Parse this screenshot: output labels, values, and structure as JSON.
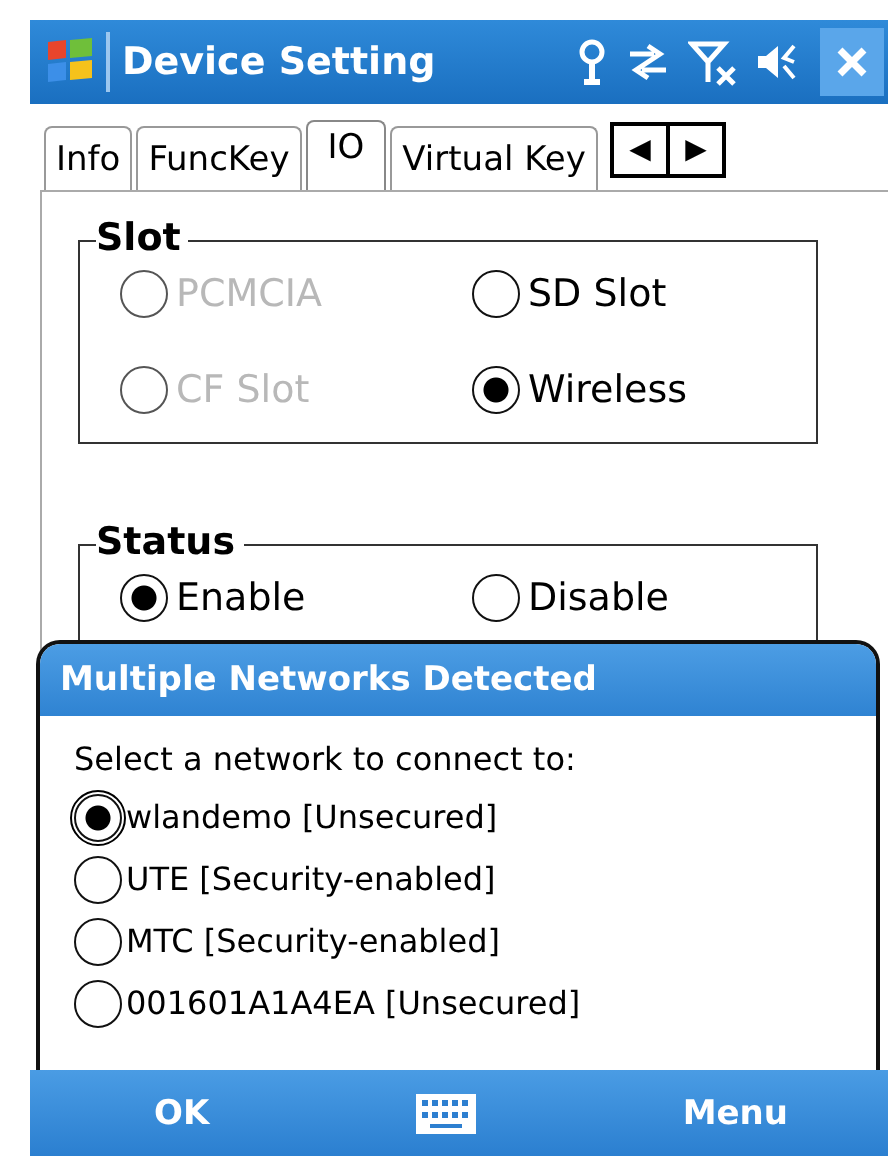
{
  "title_bar": {
    "title": "Device Setting"
  },
  "tabs": [
    {
      "label": "Info",
      "selected": false
    },
    {
      "label": "FuncKey",
      "selected": false
    },
    {
      "label": "IO",
      "selected": true
    },
    {
      "label": "Virtual Key",
      "selected": false
    }
  ],
  "tab_scroll": {
    "left": "◀",
    "right": "▶"
  },
  "groups": [
    {
      "label": "Slot",
      "options": [
        {
          "label": "PCMCIA",
          "selected": false,
          "disabled": true
        },
        {
          "label": "SD Slot",
          "selected": false,
          "disabled": false
        },
        {
          "label": "CF Slot",
          "selected": false,
          "disabled": true
        },
        {
          "label": "Wireless",
          "selected": true,
          "disabled": false
        }
      ]
    },
    {
      "label": "Status",
      "options": [
        {
          "label": "Enable",
          "selected": true,
          "disabled": false
        },
        {
          "label": "Disable",
          "selected": false,
          "disabled": false
        }
      ]
    }
  ],
  "dialog": {
    "title": "Multiple Networks Detected",
    "prompt": "Select a network to connect to:",
    "networks": [
      {
        "label": "wlandemo [Unsecured]",
        "selected": true
      },
      {
        "label": "UTE [Security-enabled]",
        "selected": false
      },
      {
        "label": "MTC [Security-enabled]",
        "selected": false
      },
      {
        "label": "001601A1A4EA [Unsecured]",
        "selected": false
      }
    ]
  },
  "menu_bar": {
    "left": "OK",
    "right": "Menu"
  }
}
